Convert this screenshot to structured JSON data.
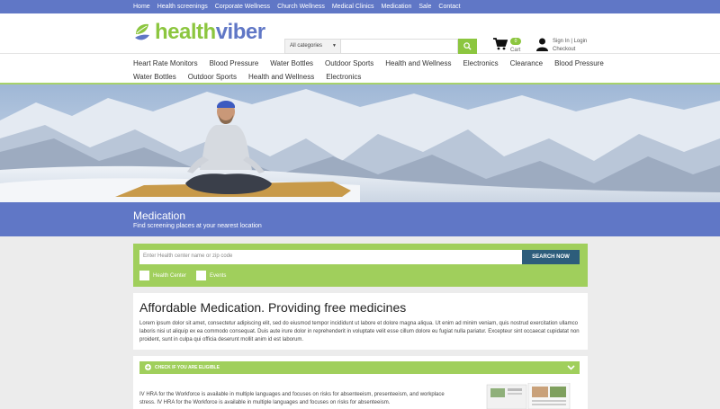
{
  "topnav": [
    "Home",
    "Health screenings",
    "Corporate Wellness",
    "Church Wellness",
    "Medical Clinics",
    "Medication",
    "Sale",
    "Contact"
  ],
  "logo": {
    "part1": "health",
    "part2": "viber"
  },
  "search": {
    "category": "All categories",
    "placeholder": ""
  },
  "cart": {
    "count": "0",
    "label": "Cart"
  },
  "account": {
    "signin": "Sign In | Login",
    "checkout": "Checkout"
  },
  "mainnav": {
    "row1": [
      "Heart Rate Monitors",
      "Blood Pressure",
      "Water Bottles",
      "Outdoor Sports",
      "Health and Wellness",
      "Electronics",
      "Clearance",
      "Blood Pressure"
    ],
    "row2": [
      "Water Bottles",
      "Outdoor Sports",
      "Health and Wellness",
      "Electronics"
    ]
  },
  "band": {
    "title": "Medication",
    "subtitle": "Find screening places at your nearest location"
  },
  "finder": {
    "placeholder": "Enter Health center name or zip code",
    "button": "SEARCH NOW",
    "option1": "Health Center",
    "option2": "Events"
  },
  "content": {
    "heading": "Affordable Medication. Providing free medicines",
    "body": "Lorem ipsum dolor sit amet, consectetur adipiscing elit, sed do eiusmod tempor incididunt ut labore et dolore magna aliqua. Ut enim ad minim veniam, quis nostrud exercitation ullamco laboris nisi ut aliquip ex ea commodo consequat. Duis aute irure dolor in reprehenderit in voluptate velit esse cillum dolore eu fugiat nulla pariatur. Excepteur sint occaecat cupidatat non proident, sunt in culpa qui officia deserunt mollit anim id est laborum."
  },
  "eligibility": {
    "header": "CHECK IF YOU ARE ELIGIBLE",
    "body": "IV HRA for the Workforce is available in multiple languages and focuses on risks for absenteeism, presenteeism, and workplace stress. IV HRA for the Workforce is available in multiple languages and focuses on risks for absenteeism."
  },
  "colors": {
    "brand_blue": "#6077c6",
    "brand_green": "#8cc63f",
    "button_dark": "#2d5d7b"
  }
}
